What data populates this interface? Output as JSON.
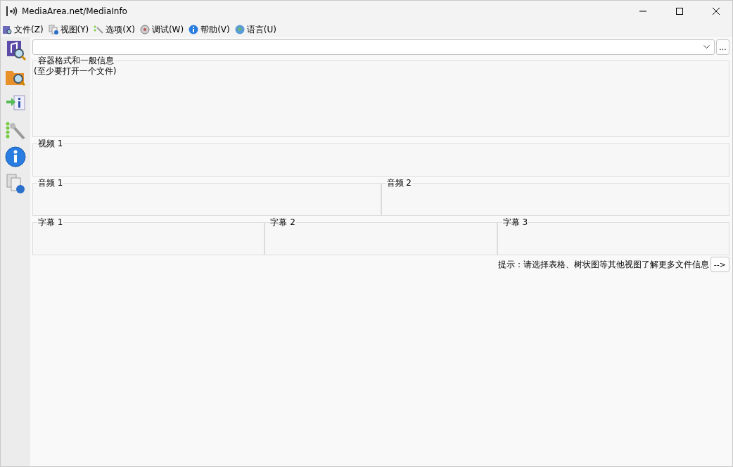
{
  "window": {
    "title": "MediaArea.net/MediaInfo"
  },
  "menu": [
    {
      "label": "文件(Z)",
      "kind": "file"
    },
    {
      "label": "视图(Y)",
      "kind": "view"
    },
    {
      "label": "选项(X)",
      "kind": "options"
    },
    {
      "label": "调试(W)",
      "kind": "debug"
    },
    {
      "label": "帮助(V)",
      "kind": "help"
    },
    {
      "label": "语言(U)",
      "kind": "language"
    }
  ],
  "file_selector": {
    "browse_button": "..."
  },
  "general": {
    "title": "容器格式和一般信息",
    "text": "(至少要打开一个文件)"
  },
  "video": [
    {
      "title": "视频 1"
    }
  ],
  "audio": [
    {
      "title": "音频 1"
    },
    {
      "title": "音频 2"
    }
  ],
  "subtitles": [
    {
      "title": "字幕 1"
    },
    {
      "title": "字幕 2"
    },
    {
      "title": "字幕 3"
    }
  ],
  "hint": {
    "text": "提示：请选择表格、树状图等其他视图了解更多文件信息",
    "button": "-->"
  }
}
